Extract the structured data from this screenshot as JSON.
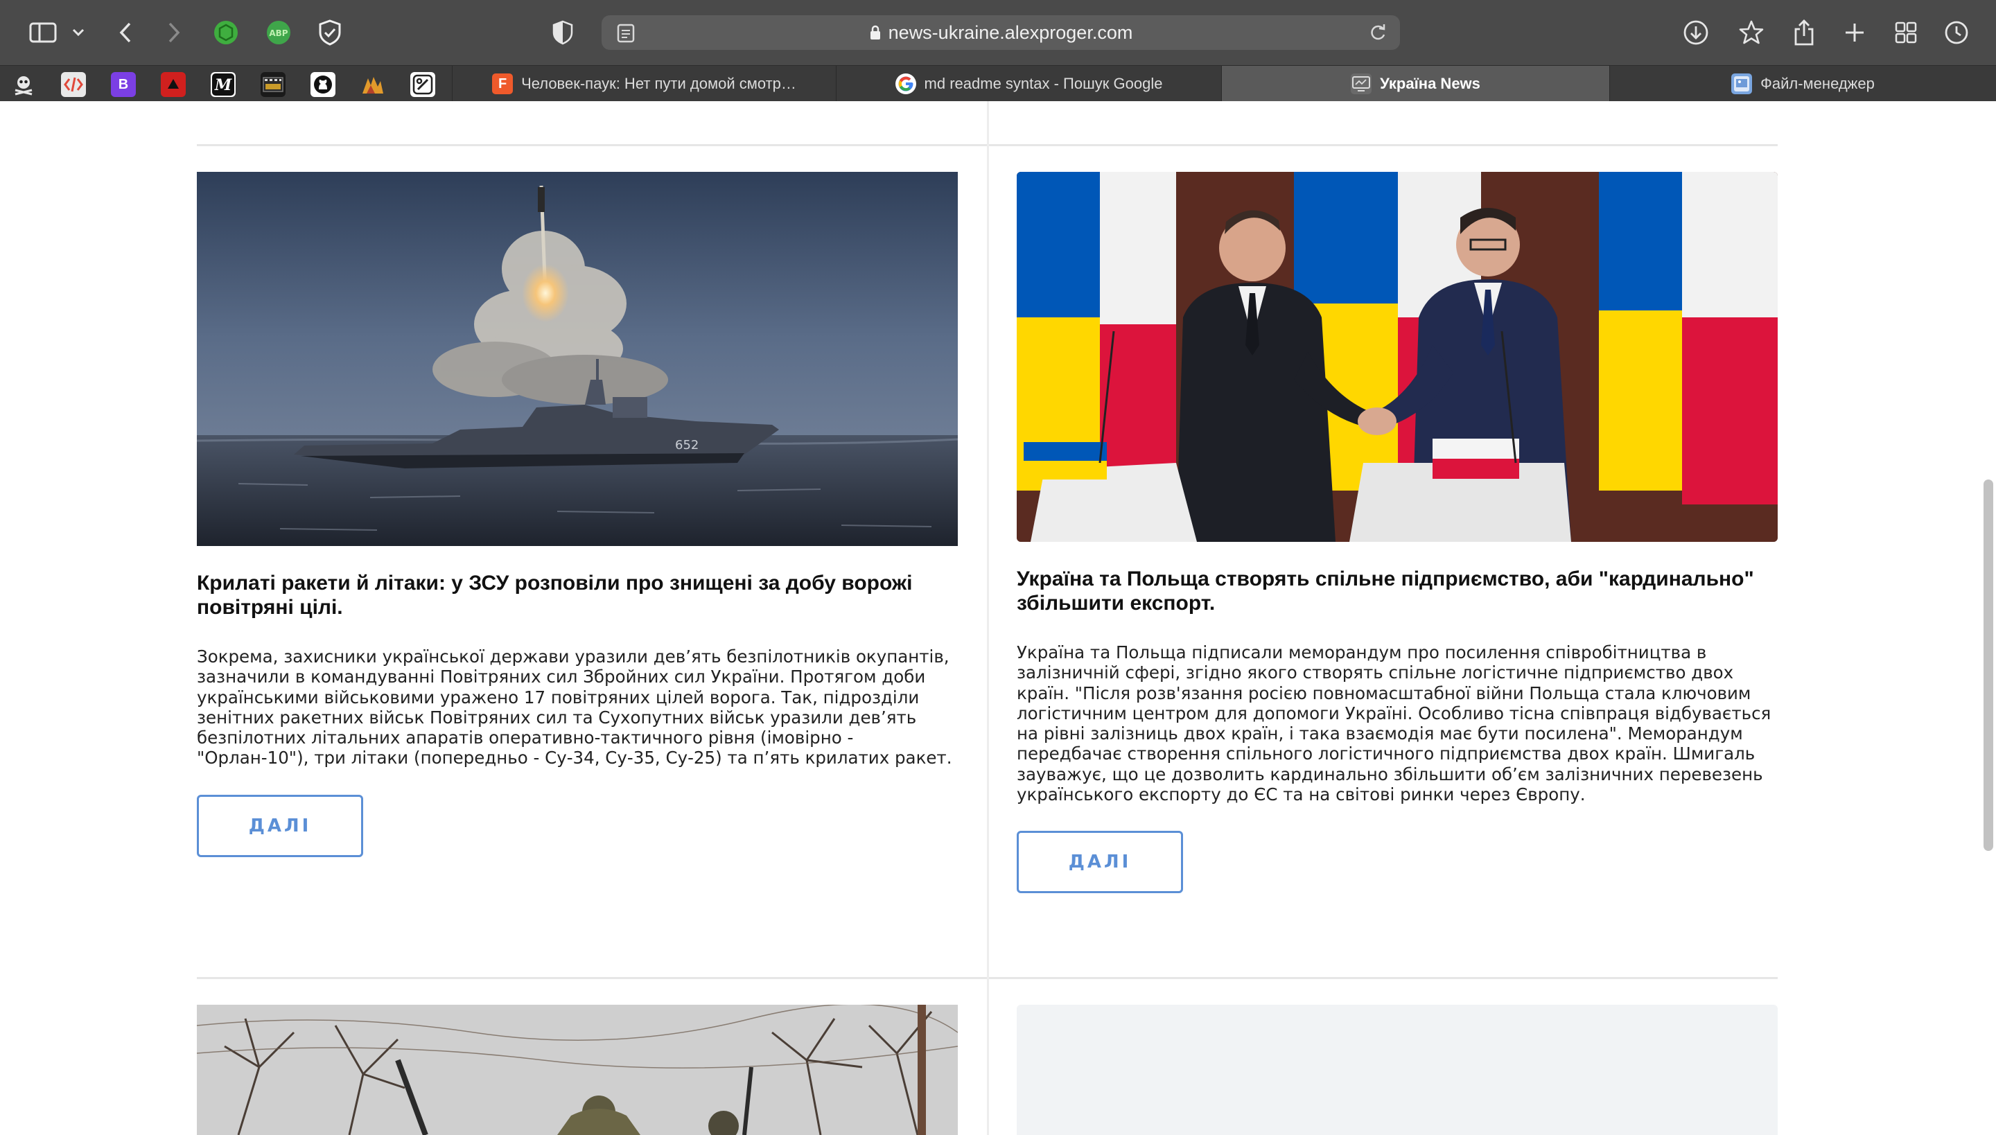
{
  "browser": {
    "url": "news-ukraine.alexproger.com",
    "bookmarks": [
      {
        "icon": "pirate-icon",
        "color": "#3a3a3a"
      },
      {
        "icon": "code-icon",
        "color": "#e9e9e9"
      },
      {
        "icon": "bootstrap-icon",
        "color": "#7b3fe4",
        "label": "B"
      },
      {
        "icon": "red-app-icon",
        "color": "#d0201e"
      },
      {
        "icon": "medium-icon",
        "color": "#111111",
        "label": "M"
      },
      {
        "icon": "film-icon",
        "color": "#1a1a1a"
      },
      {
        "icon": "github-icon",
        "color": "#ffffff"
      },
      {
        "icon": "anime-icon",
        "color": "#3a3a3a"
      },
      {
        "icon": "tool-icon",
        "color": "#ffffff"
      }
    ],
    "tabs": [
      {
        "title": "Человек-паук: Нет пути домой смотр…",
        "icon_label": "F",
        "icon_color": "#ef5a2b",
        "active": false
      },
      {
        "title": "md readme syntax - Пошук Google",
        "icon_label": "G",
        "icon_color": "#ffffff",
        "active": false
      },
      {
        "title": "Україна News",
        "icon_label": "",
        "icon_color": "#8a8a8a",
        "active": true
      },
      {
        "title": "Файл-менеджер",
        "icon_label": "",
        "icon_color": "#7aa6e0",
        "active": false
      }
    ]
  },
  "articles": [
    {
      "title": "Крилаті ракети й літаки: у ЗСУ розповіли про знищені за добу ворожі повітряні цілі.",
      "text": "Зокрема, захисники української держави уразили дев’ять безпілотників окупантів, зазначили в командуванні Повітряних сил Збройних сил України. Протягом доби українськими військовими уражено 17 повітряних цілей ворога. Так, підрозділи зенітних ракетних військ Повітряних сил та Сухопутних військ уразили дев’ять безпілотних літальних апаратів оперативно-тактичного рівня (імовірно - \"Орлан-10\"), три літаки (попередньо - Су-34, Су-35, Су-25) та п’ять крилатих ракет.",
      "button": "ДАЛІ",
      "image": "missile-launch-from-warship"
    },
    {
      "title": "Україна та Польща створять спільне підприємство, аби \"кардинально\" збільшити експорт.",
      "text": "Україна та Польща підписали меморандум про посилення співробітництва в залізничній сфері, згідно якого створять спільне логістичне підприємство двох країн. \"Після розв'язання росією повномасштабної війни Польща стала ключовим логістичним центром для допомоги Україні. Особливо тісна співпраця відбувається на рівні залізниць двох країн, і така взаємодія має бути посилена\". Меморандум передбачає створення спільного логістичного підприємства двох країн. Шмигаль зауважує, що це дозволить кардинально збільшити об’єм залізничних перевезень українського експорту до ЄС та на світові ринки через Європу.",
      "button": "ДАЛІ",
      "image": "prime-ministers-handshake"
    }
  ],
  "colors": {
    "accent": "#5b8fd6",
    "toolbar": "#4a4a4a",
    "ukraine_blue": "#0057b7",
    "ukraine_yellow": "#ffd700",
    "poland_red": "#dc143c"
  }
}
